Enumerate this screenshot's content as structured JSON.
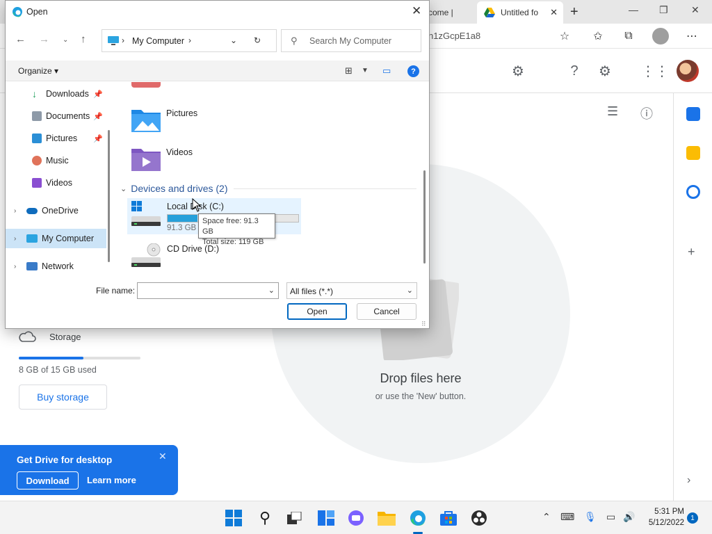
{
  "browser": {
    "tabs": [
      {
        "label": "come |"
      },
      {
        "label": "Untitled fo"
      }
    ],
    "url_fragment": "n1zGcpE1a8"
  },
  "drive": {
    "storage": {
      "label": "Storage",
      "used_text": "8 GB of 15 GB used",
      "used_fraction": 0.53,
      "buy_label": "Buy storage"
    },
    "empty_state": {
      "title": "Drop files here",
      "subtitle": "or use the 'New' button."
    },
    "promo": {
      "title": "Get Drive for desktop",
      "download_label": "Download",
      "learn_more_label": "Learn more"
    }
  },
  "dialog": {
    "title": "Open",
    "breadcrumb": "My Computer",
    "search_placeholder": "Search My Computer",
    "organize_label": "Organize",
    "nav_items": [
      {
        "label": "Downloads",
        "icon": "download-icon",
        "pinned": true
      },
      {
        "label": "Documents",
        "icon": "documents-icon",
        "pinned": true
      },
      {
        "label": "Pictures",
        "icon": "pictures-icon",
        "pinned": true
      },
      {
        "label": "Music",
        "icon": "music-icon",
        "pinned": false
      },
      {
        "label": "Videos",
        "icon": "videos-icon",
        "pinned": false
      },
      {
        "label": "OneDrive",
        "icon": "onedrive-icon",
        "pinned": false
      },
      {
        "label": "My Computer",
        "icon": "computer-icon",
        "pinned": false,
        "selected": true
      },
      {
        "label": "Network",
        "icon": "network-icon",
        "pinned": false
      }
    ],
    "folders": [
      {
        "label": "Pictures"
      },
      {
        "label": "Videos"
      }
    ],
    "group_header": "Devices and drives (2)",
    "drives": [
      {
        "label": "Local Disk (C:)",
        "free_text": "91.3 GB",
        "used_fraction": 0.23
      },
      {
        "label": "CD Drive (D:)"
      }
    ],
    "tooltip": {
      "line1": "Space free: 91.3 GB",
      "line2": "Total size: 119 GB"
    },
    "filename_label": "File name:",
    "filename_value": "",
    "filetype_value": "All files (*.*)",
    "open_label": "Open",
    "cancel_label": "Cancel"
  },
  "taskbar": {
    "time": "5:31 PM",
    "date": "5/12/2022",
    "notification_count": "1"
  },
  "colors": {
    "accent": "#1a73e8",
    "windows_accent": "#0067c0",
    "selection": "#cce4f7"
  }
}
